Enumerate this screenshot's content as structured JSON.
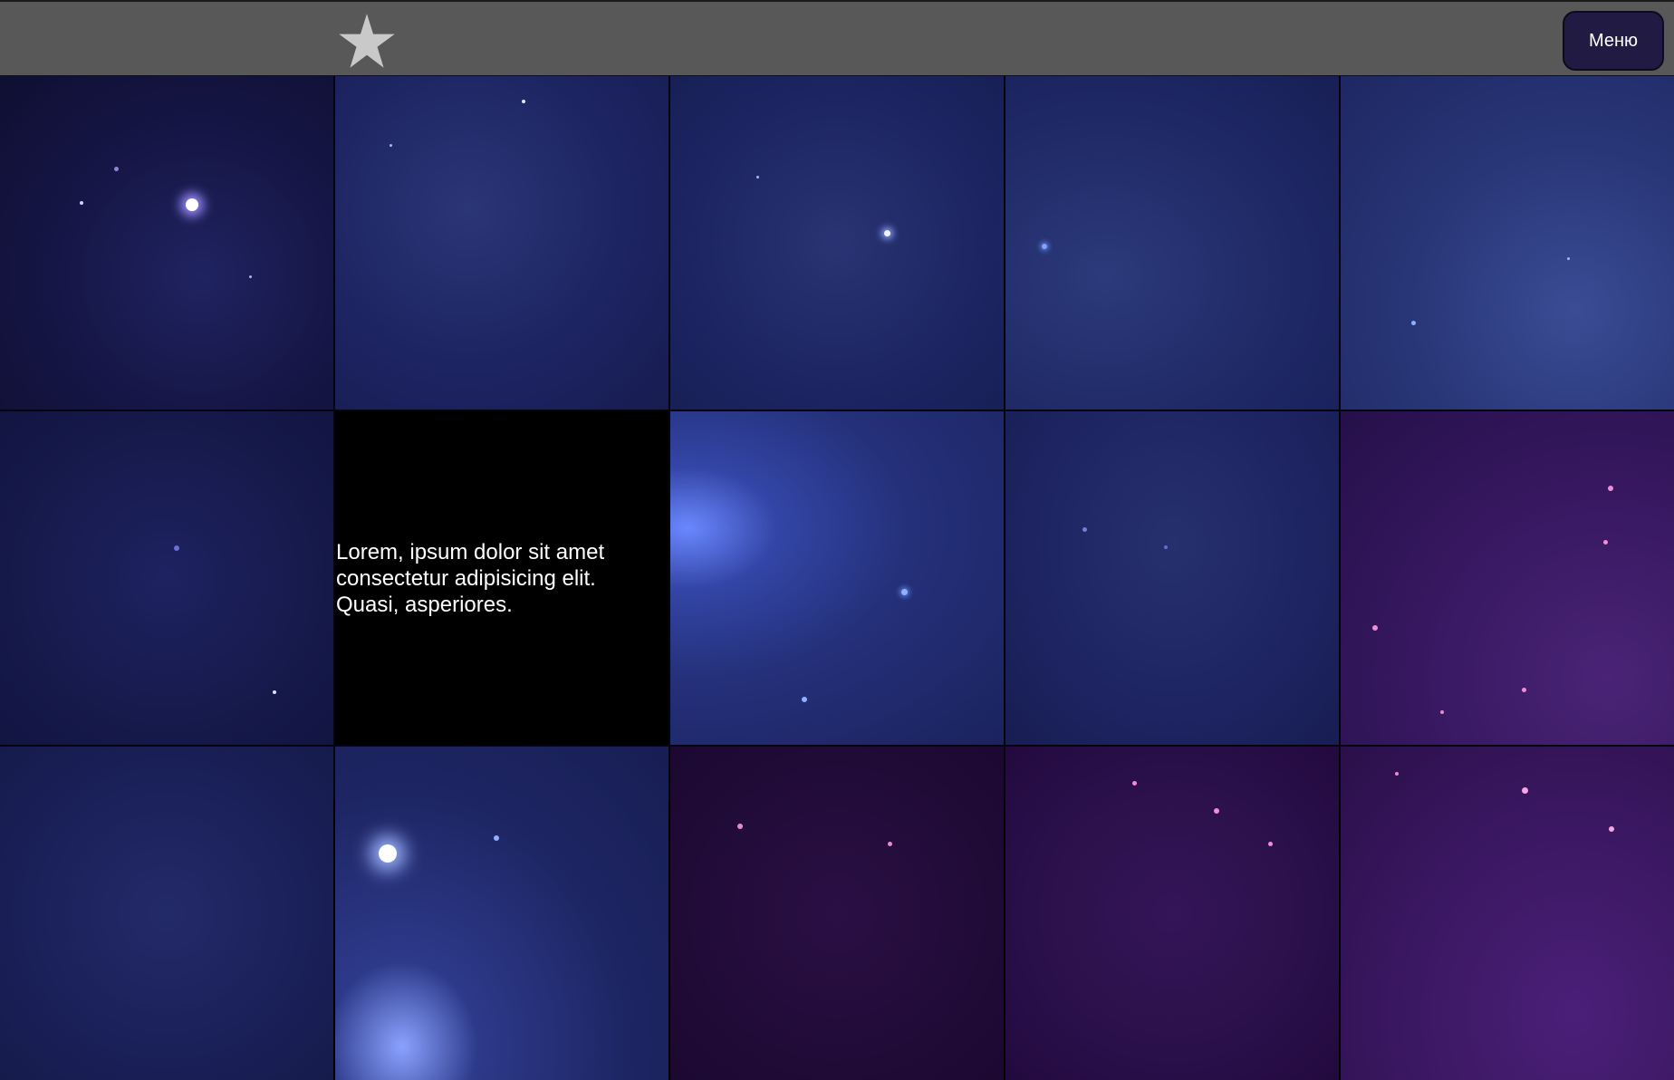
{
  "header": {
    "menu_label": "Меню",
    "star_icon": "star-icon",
    "colors": {
      "bar": "#585858",
      "menu_button": "#211b44",
      "star": "#c9c9c9"
    }
  },
  "grid": {
    "text_tile": {
      "text": "Lorem, ipsum dolor sit amet consectetur adipisicing elit. Quasi, asperiores."
    }
  }
}
